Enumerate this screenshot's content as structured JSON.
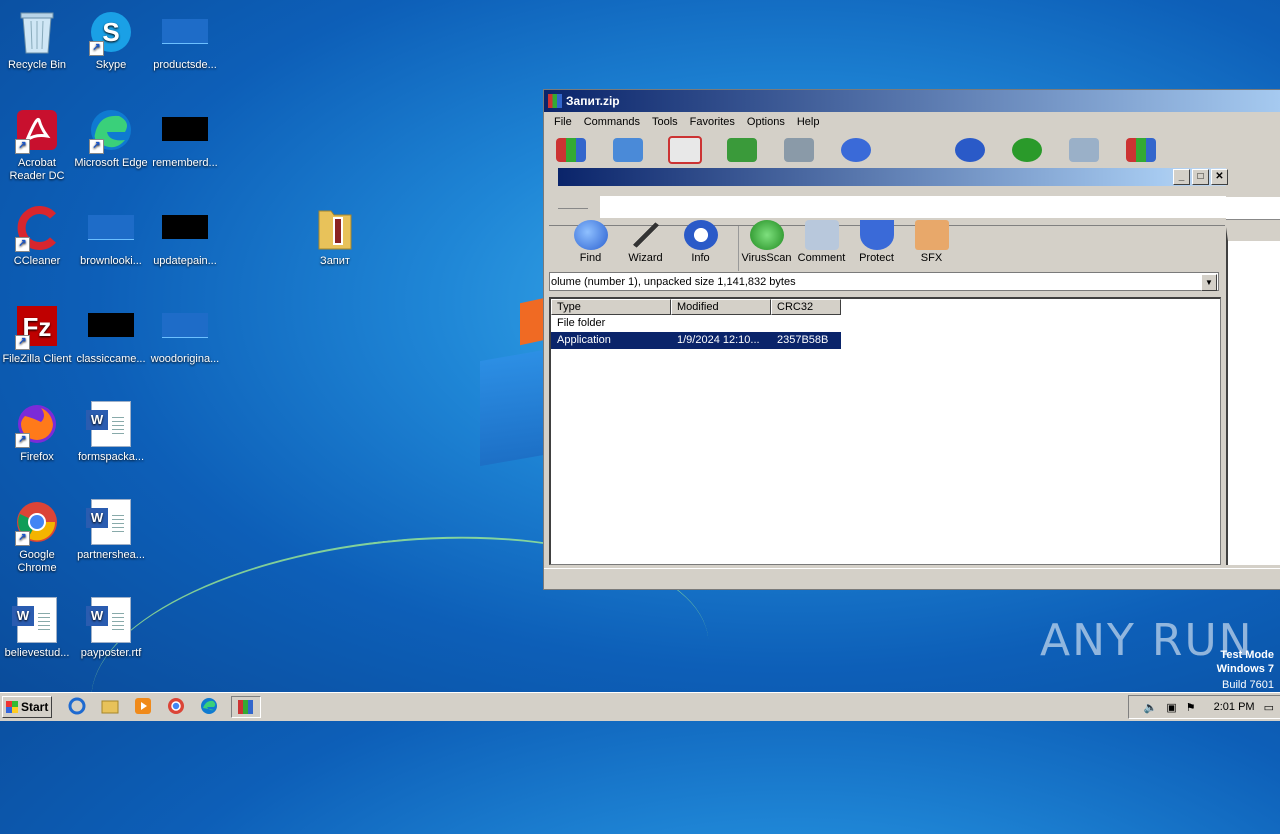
{
  "desktop": {
    "icons": [
      {
        "label": "Recycle Bin"
      },
      {
        "label": "Skype"
      },
      {
        "label": "productsde..."
      },
      {
        "label": "Acrobat Reader DC"
      },
      {
        "label": "Microsoft Edge"
      },
      {
        "label": "rememberd..."
      },
      {
        "label": "CCleaner"
      },
      {
        "label": "brownlooki..."
      },
      {
        "label": "updatepain..."
      },
      {
        "label": "Запит"
      },
      {
        "label": "FileZilla Client"
      },
      {
        "label": "classiccame..."
      },
      {
        "label": "woodorigina..."
      },
      {
        "label": "Firefox"
      },
      {
        "label": "formspacka..."
      },
      {
        "label": "Google Chrome"
      },
      {
        "label": "partnershea..."
      },
      {
        "label": "believestud..."
      },
      {
        "label": "payposter.rtf"
      }
    ]
  },
  "winrar": {
    "title": "Запит.zip",
    "menu": [
      "File",
      "Commands",
      "Tools",
      "Favorites",
      "Options",
      "Help"
    ],
    "toolbar2": [
      {
        "label": "Find",
        "icon": "find-icon"
      },
      {
        "label": "Wizard",
        "icon": "wizard-icon"
      },
      {
        "label": "Info",
        "icon": "info-icon"
      },
      {
        "label": "VirusScan",
        "icon": "virusscan-icon"
      },
      {
        "label": "Comment",
        "icon": "comment-icon"
      },
      {
        "label": "Protect",
        "icon": "protect-icon"
      },
      {
        "label": "SFX",
        "icon": "sfx-icon"
      }
    ],
    "info_text": "olume (number 1), unpacked size 1,141,832 bytes",
    "columns": [
      "Type",
      "Modified",
      "CRC32"
    ],
    "rows": [
      {
        "type": "File folder",
        "modified": "",
        "crc": ""
      },
      {
        "type": "Application",
        "modified": "1/9/2024 12:10...",
        "crc": "2357B58B"
      }
    ],
    "inner_controls": [
      "_",
      "□",
      "✕"
    ]
  },
  "taskbar": {
    "start_label": "Start",
    "clock": "2:01 PM"
  },
  "watermark": {
    "line1": "Test Mode",
    "line2": "Windows 7",
    "line3": "Build 7601",
    "brand": "ANY RUN"
  },
  "colors": {
    "title_gradient_start": "#0a246a",
    "selection": "#0a246a",
    "window_face": "#d4d0c8"
  }
}
